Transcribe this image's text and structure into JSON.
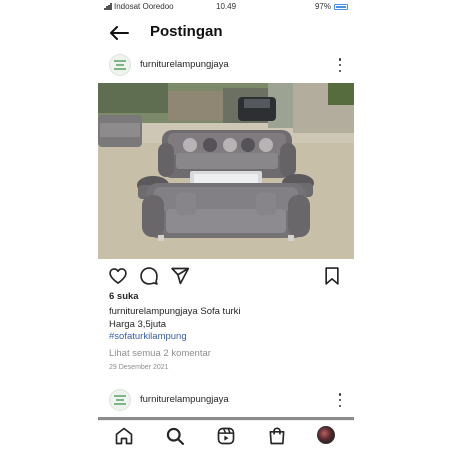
{
  "status_bar": {
    "carrier": "Indosat Ooredoo",
    "time": "10.49",
    "battery": "97%"
  },
  "header": {
    "title": "Postingan"
  },
  "post": {
    "username": "furniturelampungjaya",
    "image_alt": "Grey tufted Chesterfield sofa set outdoors",
    "likes": "6 suka",
    "caption_user": "furniturelampungjaya",
    "caption_text": "Sofa turki",
    "caption_line2": "Harga 3,5juta",
    "hashtag": "#sofaturkilampung",
    "comments_link": "Lihat semua 2 komentar",
    "date": "29 Desember 2021"
  },
  "next_post": {
    "username": "furniturelampungjaya"
  },
  "icons": {
    "back": "arrow-left-icon",
    "more": "more-vertical-icon",
    "like": "heart-icon",
    "comment": "comment-icon",
    "share": "send-icon",
    "save": "bookmark-icon",
    "home": "home-icon",
    "search": "search-icon",
    "reels": "reels-icon",
    "shop": "shop-icon",
    "profile": "profile-avatar"
  },
  "colors": {
    "hashtag": "#3a5da8",
    "muted": "#8e8e8e",
    "battery": "#4a90e2"
  }
}
